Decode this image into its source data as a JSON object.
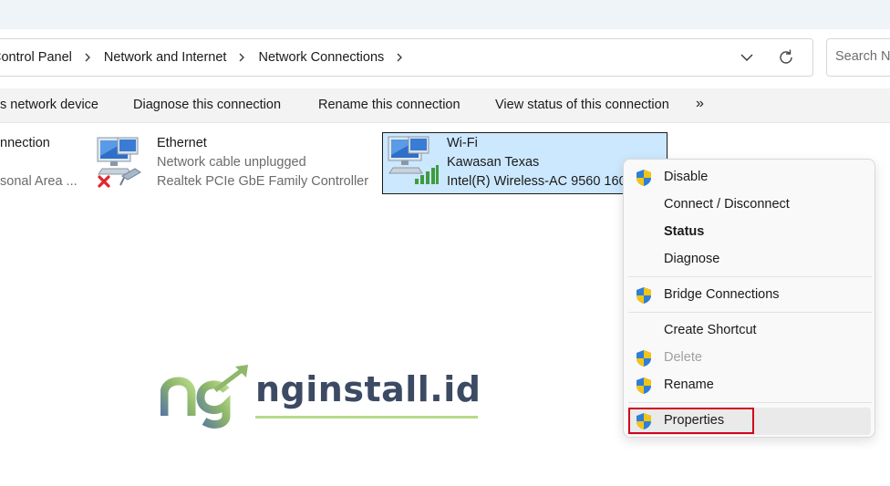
{
  "address_bar": {
    "breadcrumbs": [
      "Control Panel",
      "Network and Internet",
      "Network Connections"
    ],
    "search_placeholder": "Search Ne"
  },
  "command_bar": {
    "items": [
      "s network device",
      "Diagnose this connection",
      "Rename this connection",
      "View status of this connection"
    ],
    "more_glyph": "»"
  },
  "connections": [
    {
      "name": "nnection",
      "status": "",
      "device": "sonal Area ..."
    },
    {
      "name": "Ethernet",
      "status": "Network cable unplugged",
      "device": "Realtek PCIe GbE Family Controller"
    },
    {
      "name": "Wi-Fi",
      "status": "Kawasan Texas",
      "device": "Intel(R) Wireless-AC 9560 160MHz",
      "selected": true
    }
  ],
  "context_menu": {
    "items": [
      {
        "label": "Disable",
        "icon": "shield-icon",
        "state": "normal"
      },
      {
        "label": "Connect / Disconnect",
        "icon": "",
        "state": "normal"
      },
      {
        "label": "Status",
        "icon": "",
        "state": "bold"
      },
      {
        "label": "Diagnose",
        "icon": "",
        "state": "normal"
      },
      {
        "label": "Bridge Connections",
        "icon": "shield-icon",
        "state": "normal"
      },
      {
        "label": "Create Shortcut",
        "icon": "",
        "state": "normal"
      },
      {
        "label": "Delete",
        "icon": "shield-icon",
        "state": "disabled"
      },
      {
        "label": "Rename",
        "icon": "shield-icon",
        "state": "normal"
      },
      {
        "label": "Properties",
        "icon": "shield-icon",
        "state": "highlighted"
      }
    ]
  },
  "watermark": {
    "text": "nginstall.id"
  },
  "colors": {
    "selection": "#cce8ff",
    "highlight_box": "#d0021b",
    "toolbar_bg": "#f3f3f3"
  }
}
